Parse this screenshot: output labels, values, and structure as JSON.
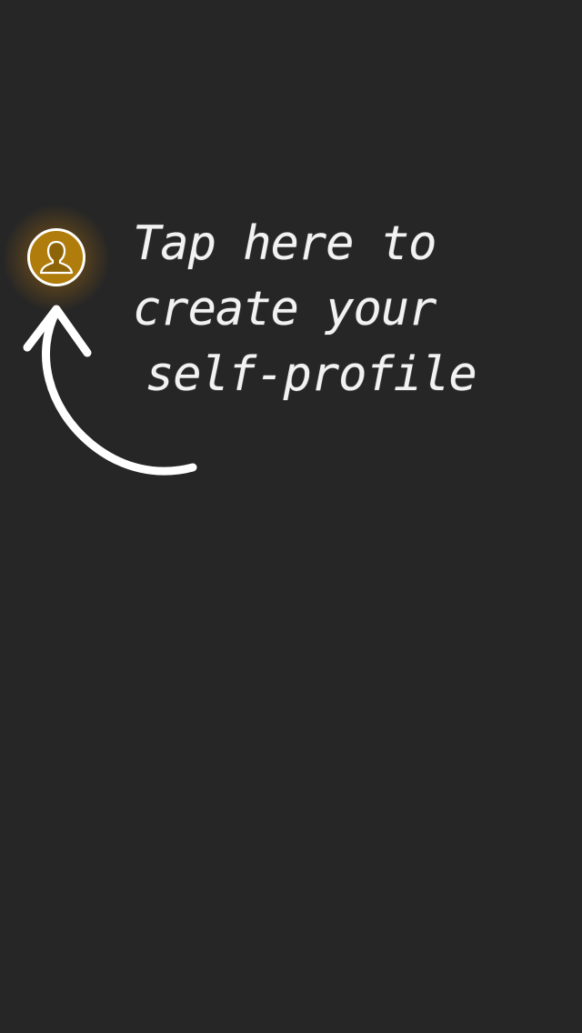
{
  "onboarding": {
    "hint_lines": [
      "Tap here to",
      "create your",
      "self-profile"
    ],
    "profile_button_icon": "person-silhouette-icon",
    "arrow_icon": "curved-arrow-up-icon"
  },
  "colors": {
    "background": "#262626",
    "accent_glow": "#d6961a",
    "text": "#f2f2f2"
  }
}
